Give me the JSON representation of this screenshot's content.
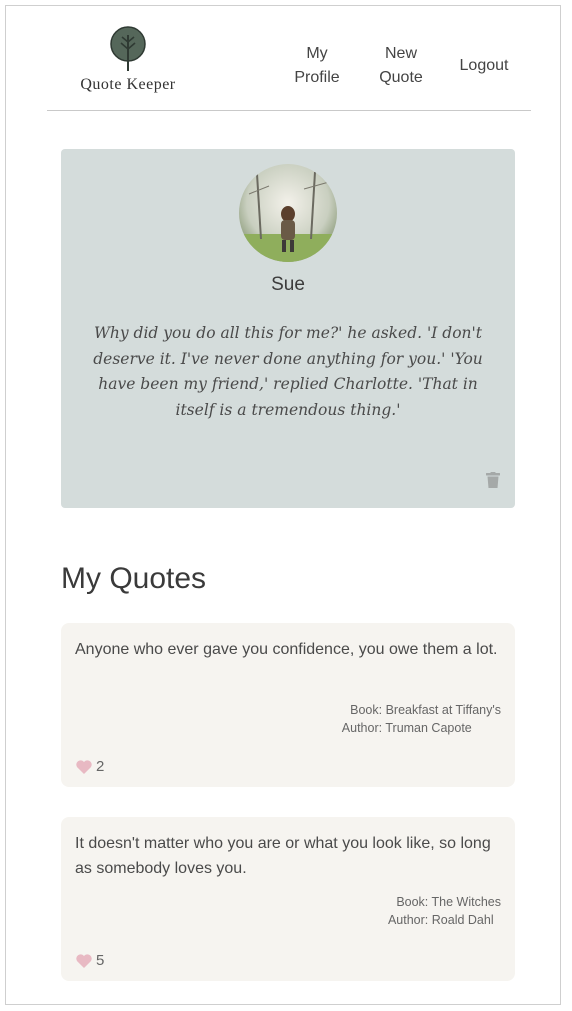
{
  "header": {
    "logo_text": "Quote Keeper",
    "nav": {
      "profile_line1": "My",
      "profile_line2": "Profile",
      "new_line1": "New",
      "new_line2": "Quote",
      "logout": "Logout"
    }
  },
  "profile": {
    "name": "Sue",
    "favorite_quote": "Why did you do all this for me?' he asked. 'I don't deserve it. I've never done anything for you.' 'You have been my friend,' replied Charlotte. 'That in itself is a tremendous thing.'",
    "delete_icon": "trash-icon"
  },
  "my_quotes": {
    "title": "My Quotes",
    "items": [
      {
        "text": "Anyone who ever gave you confidence, you owe them a lot.",
        "book_label": "Book:",
        "book": "Breakfast at Tiffany's",
        "author_label": "Author:",
        "author": "Truman Capote",
        "likes": "2"
      },
      {
        "text": "It doesn't matter who you are or what you look like, so long as somebody loves you.",
        "book_label": "Book:",
        "book": "The Witches",
        "author_label": "Author:",
        "author": "Roald Dahl",
        "likes": "5"
      }
    ]
  },
  "colors": {
    "profile_card_bg": "#d4dcdb",
    "quote_card_bg": "#f6f4f0",
    "heart": "#e8b9c3",
    "logo_green": "#55675a"
  }
}
